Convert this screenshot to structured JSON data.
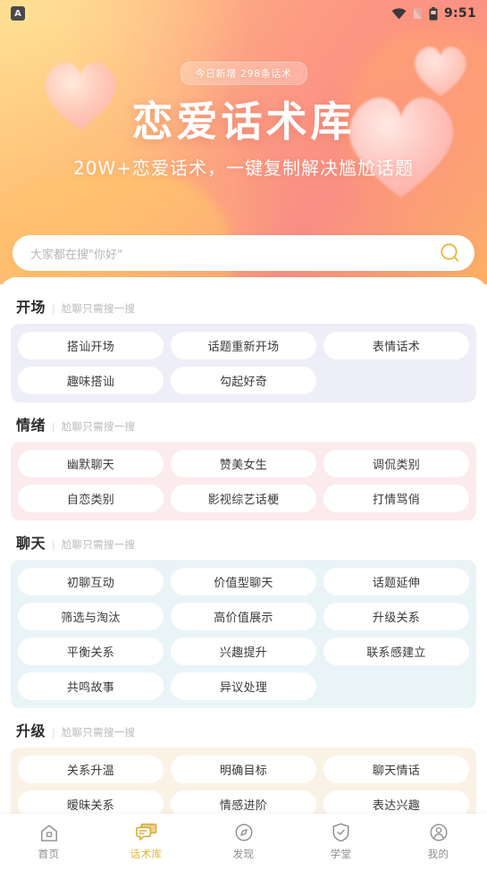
{
  "status_bar": {
    "app_icon": "A",
    "time": "9:51",
    "icons": [
      "wifi-icon",
      "signal-icon",
      "battery-icon"
    ]
  },
  "banner": {
    "badge": "今日新增 298条话术",
    "title": "恋爱话术库",
    "subtitle": "20W+恋爱话术，一键复制解决尴尬话题",
    "gradient_from": "#ffd489",
    "gradient_to": "#f98d84",
    "heart_color": "#ffb0b0"
  },
  "search": {
    "placeholder": "大家都在搜\"你好\"",
    "icon": "search-icon",
    "icon_color": "#e8b63c"
  },
  "sections": [
    {
      "title": "开场",
      "divider": "|",
      "subtitle": "尬聊只需搜一搜",
      "panel_color": "#eeeef8",
      "chips": [
        "搭讪开场",
        "话题重新开场",
        "表情话术",
        "趣味搭讪",
        "勾起好奇"
      ]
    },
    {
      "title": "情绪",
      "divider": "|",
      "subtitle": "尬聊只需搜一搜",
      "panel_color": "#fcebec",
      "chips": [
        "幽默聊天",
        "赞美女生",
        "调侃类别",
        "自恋类别",
        "影视综艺话梗",
        "打情骂俏"
      ]
    },
    {
      "title": "聊天",
      "divider": "|",
      "subtitle": "尬聊只需搜一搜",
      "panel_color": "#e9f4f7",
      "chips": [
        "初聊互动",
        "价值型聊天",
        "话题延伸",
        "筛选与淘汰",
        "高价值展示",
        "升级关系",
        "平衡关系",
        "兴趣提升",
        "联系感建立",
        "共鸣故事",
        "异议处理"
      ]
    },
    {
      "title": "升级",
      "divider": "|",
      "subtitle": "尬聊只需搜一搜",
      "panel_color": "#fbf2e6",
      "chips": [
        "关系升温",
        "明确目标",
        "聊天情话",
        "暧昧关系",
        "情感进阶",
        "表达兴趣"
      ]
    }
  ],
  "tabbar": {
    "active_color": "#e3b53a",
    "inactive_color": "#8d8d8d",
    "items": [
      {
        "label": "首页",
        "icon": "home-icon",
        "active": false
      },
      {
        "label": "话术库",
        "icon": "chat-bubbles-icon",
        "active": true
      },
      {
        "label": "发现",
        "icon": "compass-icon",
        "active": false
      },
      {
        "label": "学堂",
        "icon": "shield-icon",
        "active": false
      },
      {
        "label": "我的",
        "icon": "person-icon",
        "active": false
      }
    ]
  }
}
